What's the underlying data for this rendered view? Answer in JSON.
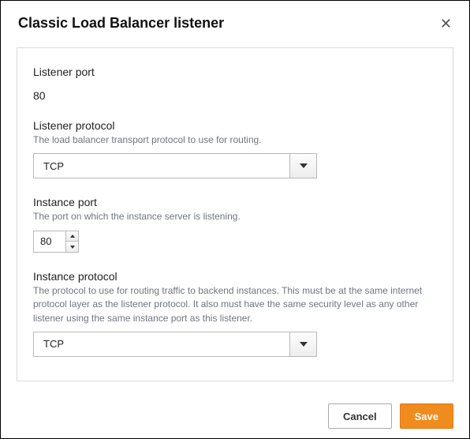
{
  "dialog": {
    "title": "Classic Load Balancer listener"
  },
  "listenerPort": {
    "label": "Listener port",
    "value": "80"
  },
  "listenerProtocol": {
    "label": "Listener protocol",
    "help": "The load balancer transport protocol to use for routing.",
    "value": "TCP"
  },
  "instancePort": {
    "label": "Instance port",
    "help": "The port on which the instance server is listening.",
    "value": "80"
  },
  "instanceProtocol": {
    "label": "Instance protocol",
    "help": "The protocol to use for routing traffic to backend instances. This must be at the same internet protocol layer as the listener protocol. It also must have the same security level as any other listener using the same instance port as this listener.",
    "value": "TCP"
  },
  "footer": {
    "cancel": "Cancel",
    "save": "Save"
  }
}
